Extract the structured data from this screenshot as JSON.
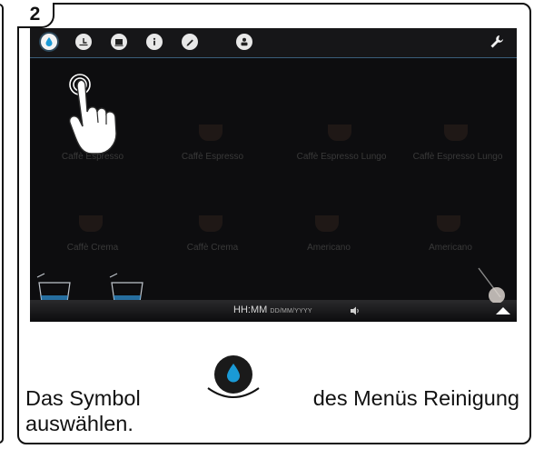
{
  "step": {
    "number": "2"
  },
  "screen": {
    "menu_icons": [
      {
        "name": "cleaning-drop-icon",
        "active": true
      },
      {
        "name": "clock-icon",
        "active": false
      },
      {
        "name": "display-icon",
        "active": false
      },
      {
        "name": "info-icon",
        "active": false
      },
      {
        "name": "edit-pencil-icon",
        "active": false
      },
      {
        "name": "user-icon",
        "active": false
      }
    ],
    "settings_icon": "wrench-icon",
    "products": [
      {
        "label": "Caffè Espresso"
      },
      {
        "label": "Caffè Espresso"
      },
      {
        "label": "Caffè Espresso Lungo"
      },
      {
        "label": "Caffè Espresso Lungo"
      },
      {
        "label": "Caffè Crema"
      },
      {
        "label": "Caffè Crema"
      },
      {
        "label": "Americano"
      },
      {
        "label": "Americano"
      }
    ],
    "status": {
      "time": "HH:MM",
      "date": "DD/MM/YYYY"
    }
  },
  "instruction": {
    "before_icon": "Das Symbol",
    "after_icon": "des Menüs Reinigung",
    "line2": "auswählen."
  },
  "colors": {
    "drop": "#1a9ad6",
    "accent_line": "#3a5e7a"
  }
}
